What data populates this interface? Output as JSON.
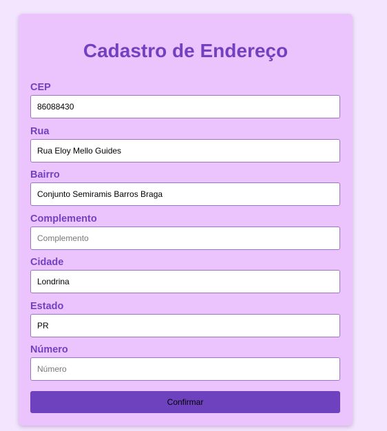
{
  "form": {
    "title": "Cadastro de Endereço",
    "fields": [
      {
        "label": "CEP",
        "value": "86088430",
        "placeholder": ""
      },
      {
        "label": "Rua",
        "value": "Rua Eloy Mello Guides",
        "placeholder": ""
      },
      {
        "label": "Bairro",
        "value": "Conjunto Semiramis Barros Braga",
        "placeholder": ""
      },
      {
        "label": "Complemento",
        "value": "",
        "placeholder": "Complemento"
      },
      {
        "label": "Cidade",
        "value": "Londrina",
        "placeholder": ""
      },
      {
        "label": "Estado",
        "value": "PR",
        "placeholder": ""
      },
      {
        "label": "Número",
        "value": "",
        "placeholder": "Número"
      }
    ],
    "submit_label": "Confirmar"
  },
  "colors": {
    "page_background": "#f3e5fd",
    "card_background": "#ebc4fe",
    "accent": "#7340c0",
    "button": "#6e41bf"
  }
}
